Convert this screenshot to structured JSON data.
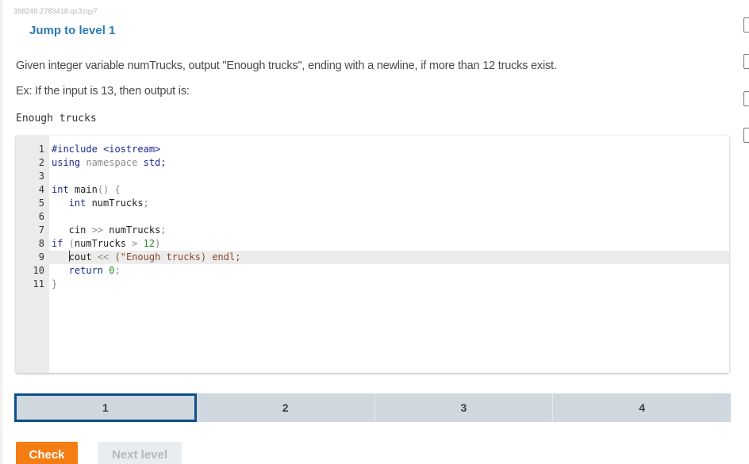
{
  "activity_id": "398240.2783418.qx3zqy7",
  "jump_link": "Jump to level 1",
  "prompt": "Given integer variable numTrucks, output \"Enough trucks\", ending with a newline, if more than 12 trucks exist.",
  "example": "Ex: If the input is 13, then output is:",
  "expected_output": "Enough trucks",
  "editor": {
    "active_line": 9,
    "lines": [
      {
        "n": "1",
        "tokens": [
          {
            "t": "#include <iostream>",
            "c": "kw"
          }
        ]
      },
      {
        "n": "2",
        "tokens": [
          {
            "t": "using",
            "c": "kw"
          },
          {
            "t": " namespace ",
            "c": "dim"
          },
          {
            "t": "std;",
            "c": "kw"
          }
        ]
      },
      {
        "n": "3",
        "tokens": []
      },
      {
        "n": "4",
        "tokens": [
          {
            "t": "int",
            "c": "kw"
          },
          {
            "t": " main",
            "c": "id"
          },
          {
            "t": "() {",
            "c": "dim"
          }
        ]
      },
      {
        "n": "5",
        "tokens": [
          {
            "t": "   int",
            "c": "kw"
          },
          {
            "t": " numTrucks",
            "c": "id"
          },
          {
            "t": ";",
            "c": "dim"
          }
        ]
      },
      {
        "n": "6",
        "tokens": []
      },
      {
        "n": "7",
        "tokens": [
          {
            "t": "   cin",
            "c": "id"
          },
          {
            "t": " >> ",
            "c": "dim"
          },
          {
            "t": "numTrucks",
            "c": "id"
          },
          {
            "t": ";",
            "c": "dim"
          }
        ]
      },
      {
        "n": "8",
        "tokens": [
          {
            "t": "if",
            "c": "kw"
          },
          {
            "t": " (",
            "c": "dim"
          },
          {
            "t": "numTrucks",
            "c": "id"
          },
          {
            "t": " > ",
            "c": "dim"
          },
          {
            "t": "12",
            "c": "num"
          },
          {
            "t": ")",
            "c": "dim"
          }
        ]
      },
      {
        "n": "9",
        "tokens": [
          {
            "t": "   ",
            "c": "id",
            "caret": true
          },
          {
            "t": "cout",
            "c": "id"
          },
          {
            "t": " << ",
            "c": "dim"
          },
          {
            "t": "(\"Enough trucks) endl;",
            "c": "str"
          }
        ]
      },
      {
        "n": "10",
        "tokens": [
          {
            "t": "   return",
            "c": "kw"
          },
          {
            "t": " ",
            "c": "id"
          },
          {
            "t": "0",
            "c": "num"
          },
          {
            "t": ";",
            "c": "dim"
          }
        ]
      },
      {
        "n": "11",
        "tokens": [
          {
            "t": "}",
            "c": "dim"
          }
        ]
      }
    ]
  },
  "levels": [
    {
      "label": "1",
      "selected": true
    },
    {
      "label": "2",
      "selected": false
    },
    {
      "label": "3",
      "selected": false
    },
    {
      "label": "4",
      "selected": false
    }
  ],
  "buttons": {
    "check": "Check",
    "next_level": "Next level"
  },
  "side_checkboxes": 4
}
